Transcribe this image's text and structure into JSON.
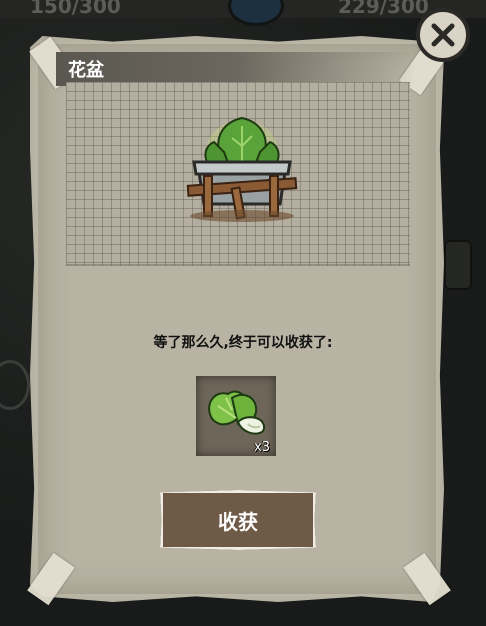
{
  "hud": {
    "left_counter": "150/300",
    "right_counter": "229/300"
  },
  "dialog": {
    "title": "花盆",
    "message": "等了那么久,终于可以收获了:",
    "reward": {
      "icon": "bok-choy-icon",
      "count_label": "x3"
    },
    "harvest_label": "收获",
    "close_icon": "close-icon"
  }
}
